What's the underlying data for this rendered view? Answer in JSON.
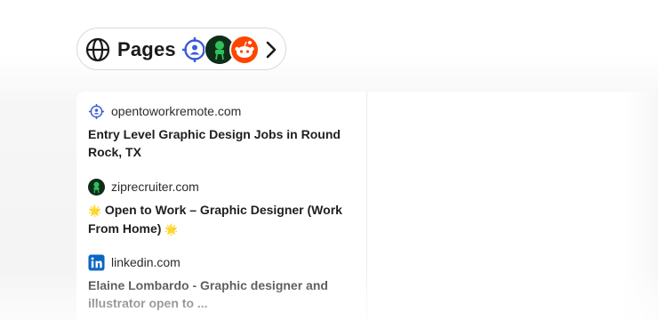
{
  "pages_button": {
    "label": "Pages"
  },
  "results": [
    {
      "domain": "opentoworkremote.com",
      "title": "Entry Level Graphic Design Jobs in Round Rock, TX",
      "favicon": "target-person-icon"
    },
    {
      "domain": "ziprecruiter.com",
      "title_prefix": "🌟",
      "title": "Open to Work – Graphic Designer (Work From Home)",
      "title_suffix": "🌟",
      "favicon": "ziprecruiter-icon"
    },
    {
      "domain": "linkedin.com",
      "title": "Elaine Lombardo - Graphic designer and illustrator open to ...",
      "favicon": "linkedin-icon"
    }
  ],
  "colors": {
    "accent_blue": "#3b5bdb",
    "zip_green": "#1f7a3a",
    "reddit_orange": "#ff4500",
    "linkedin_blue": "#0a66c2"
  }
}
